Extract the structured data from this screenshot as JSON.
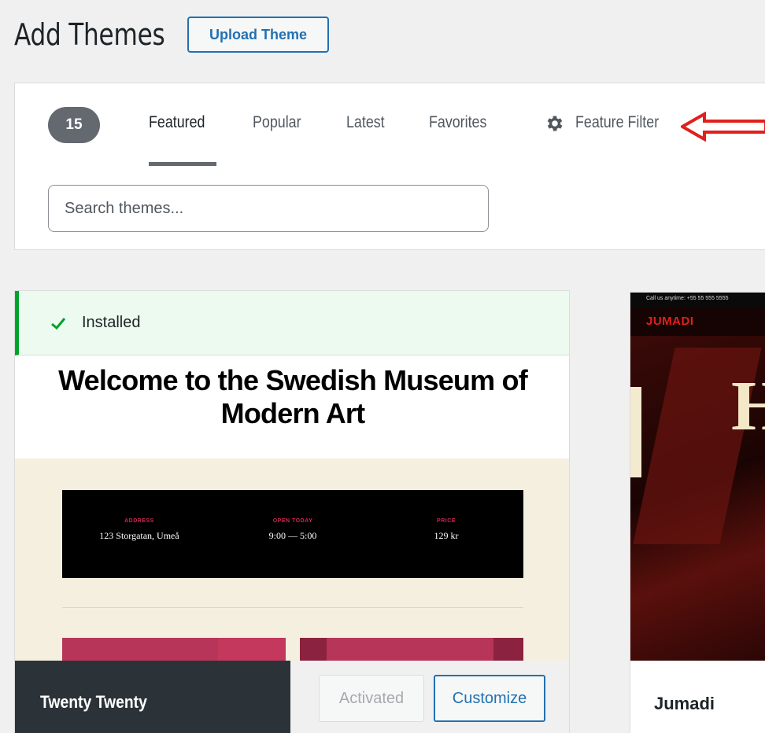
{
  "header": {
    "title": "Add Themes",
    "upload_label": "Upload Theme"
  },
  "filter": {
    "count": "15",
    "tabs": [
      "Featured",
      "Popular",
      "Latest",
      "Favorites"
    ],
    "active_tab": "Featured",
    "feature_filter_label": "Feature Filter",
    "search_placeholder": "Search themes..."
  },
  "themes": [
    {
      "name": "Twenty Twenty",
      "installed_label": "Installed",
      "activated_label": "Activated",
      "customize_label": "Customize",
      "preview": {
        "headline": "Welcome to the Swedish Museum of Modern Art",
        "info": [
          {
            "label": "ADDRESS",
            "value": "123 Storgatan, Umeå"
          },
          {
            "label": "OPEN TODAY",
            "value": "9:00 — 5:00"
          },
          {
            "label": "PRICE",
            "value": "129 kr"
          }
        ]
      }
    },
    {
      "name": "Jumadi",
      "preview": {
        "topbar": "Call us anytime: +55 55 555 5555",
        "brand": "JUMADI",
        "hero_letter": "H"
      }
    }
  ],
  "colors": {
    "accent": "#2271b1",
    "installed_bg": "#edfaef",
    "installed_border": "#00a32a",
    "annotation_arrow": "#e0201b"
  }
}
